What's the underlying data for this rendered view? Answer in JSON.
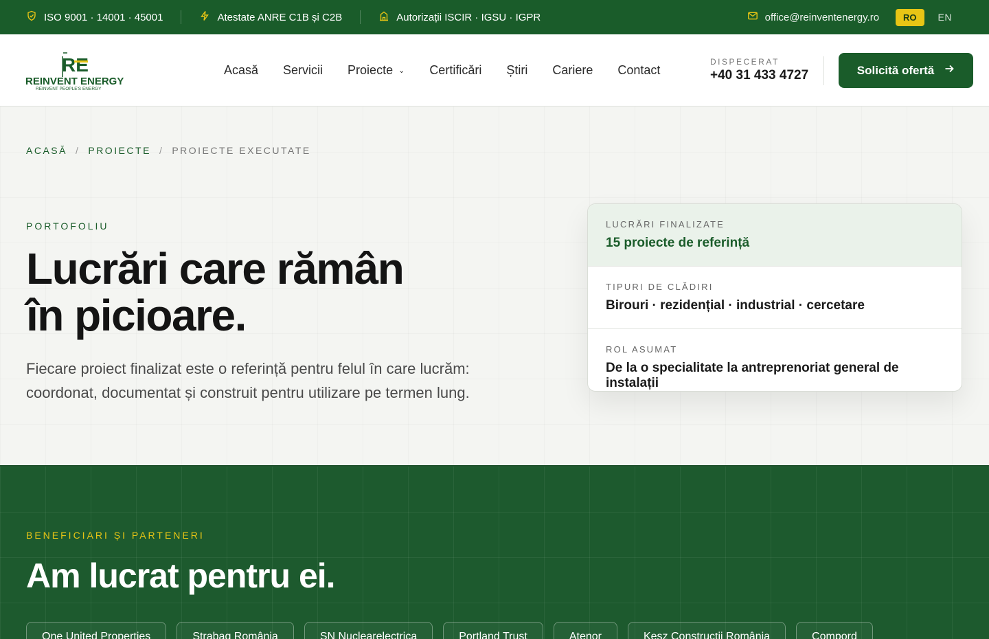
{
  "topbar": {
    "iso": "ISO 9001 · 14001 · 45001",
    "anre": "Atestate ANRE C1B și C2B",
    "authorizations": "Autorizații ISCIR · IGSU · IGPR",
    "email": "office@reinventenergy.ro",
    "lang_ro": "RO",
    "lang_en": "EN"
  },
  "logo": {
    "mark": "RE",
    "name": "REINVENT ENERGY",
    "tagline": "REINVENT PEOPLE'S ENERGY"
  },
  "nav": {
    "items": [
      "Acasă",
      "Servicii",
      "Proiecte",
      "Certificări",
      "Știri",
      "Cariere",
      "Contact"
    ]
  },
  "dispatch": {
    "label": "DISPECERAT",
    "phone": "+40 31 433 4727"
  },
  "cta": {
    "label": "Solicită ofertă"
  },
  "breadcrumb": {
    "home": "ACASĂ",
    "section": "PROIECTE",
    "current": "PROIECTE EXECUTATE"
  },
  "hero": {
    "eyebrow": "PORTOFOLIU",
    "title_line1": "Lucrări care rămân",
    "title_line2": "în picioare.",
    "lead": "Fiecare proiect finalizat este o referință pentru felul în care lucrăm: coordonat, documentat și construit pentru utilizare pe termen lung."
  },
  "facts": [
    {
      "key": "LUCRĂRI FINALIZATE",
      "value": "15 proiecte de referință"
    },
    {
      "key": "TIPURI DE CLĂDIRI",
      "value": "Birouri · rezidențial · industrial · cercetare"
    },
    {
      "key": "ROL ASUMAT",
      "value": "De la o specialitate la antreprenoriat general de instalații"
    }
  ],
  "partners": {
    "eyebrow": "BENEFICIARI ȘI PARTENERI",
    "title": "Am lucrat pentru ei.",
    "chips": [
      "One United Properties",
      "Strabag România",
      "SN Nuclearelectrica",
      "Portland Trust",
      "Atenor",
      "Kesz Construcții România",
      "Compord"
    ]
  },
  "colors": {
    "brand_green": "#1a5c2a",
    "accent_yellow": "#e8c515"
  }
}
